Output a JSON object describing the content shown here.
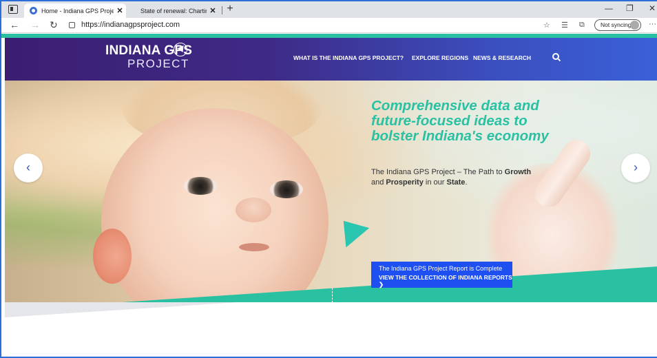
{
  "browser": {
    "tabs": [
      {
        "title": "Home - Indiana GPS Project",
        "close": "✕"
      },
      {
        "title": "State of renewal: Charting a new",
        "close": "✕"
      }
    ],
    "new_tab": "+",
    "window_controls": {
      "minimize": "—",
      "restore": "❐",
      "close": "✕"
    },
    "url": "https://indianagpsproject.com",
    "sync_label": "Not syncing",
    "nav": {
      "back": "←",
      "forward": "→",
      "refresh": "↻"
    },
    "menu": "···"
  },
  "site": {
    "logo": {
      "main": "INDIANA GPS",
      "sub": "PROJECT"
    },
    "nav": [
      "WHAT IS THE INDIANA GPS PROJECT?",
      "EXPLORE REGIONS",
      "NEWS & RESEARCH"
    ],
    "hero": {
      "headline": "Comprehensive data and future-focused ideas to bolster Indiana's economy",
      "sub_prefix": "The Indiana GPS Project – The Path to ",
      "sub_growth": "Growth",
      "sub_and": " and ",
      "sub_prosperity": "Prosperity",
      "sub_mid": " in our ",
      "sub_state": "State",
      "sub_end": ".",
      "prev_arrow": "‹",
      "next_arrow": "›"
    },
    "cta": {
      "line1": "The Indiana GPS Project Report is Complete",
      "line2": "VIEW THE COLLECTION OF INDIANA REPORTS ❯"
    }
  },
  "colors": {
    "accent_teal": "#2ac1a3",
    "cta_blue": "#1e4ff0",
    "header_purple": "#3b1e72",
    "header_blue": "#3a60d8"
  }
}
